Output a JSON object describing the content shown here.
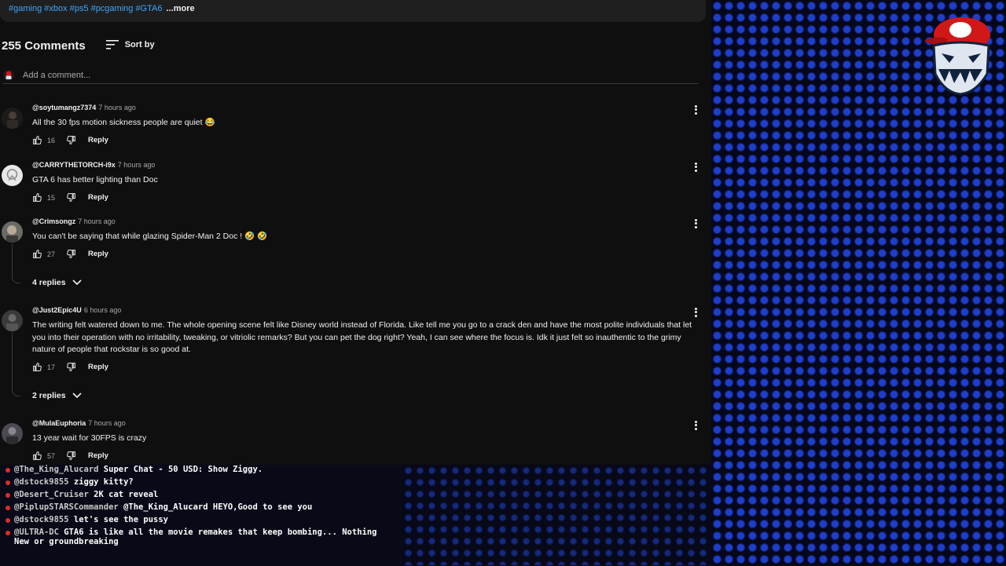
{
  "description": {
    "tags": "#gaming #xbox #ps5 #pcgaming #GTA6",
    "more_label": "...more"
  },
  "comments_header": {
    "count_label": "255 Comments",
    "sort_label": "Sort by",
    "add_comment_placeholder": "Add a comment..."
  },
  "comments": [
    {
      "author": "@soytumangz7374",
      "time": "7 hours ago",
      "text": "All the 30 fps motion sickness people are quiet 😂",
      "likes": "16",
      "reply_label": "Reply"
    },
    {
      "author": "@CARRYTHETORCH-i9x",
      "time": "7 hours ago",
      "text": "GTA 6 has better lighting than Doc",
      "likes": "15",
      "reply_label": "Reply"
    },
    {
      "author": "@Crimsongz",
      "time": "7 hours ago",
      "text": "You can't be saying that while glazing Spider-Man 2 Doc ! 🤣 🤣",
      "likes": "27",
      "reply_label": "Reply",
      "replies_label": "4 replies"
    },
    {
      "author": "@Just2Epic4U",
      "time": "6 hours ago",
      "text": "The writing felt watered down to me. The whole opening scene felt like Disney world instead of Florida. Like tell me you go to a crack den and have the most polite individuals that let you into their operation with no irritability, tweaking, or vitriolic remarks? But you can pet the dog right? Yeah, I can see where the focus is. Idk it just felt so inauthentic to the grimy nature of people that rockstar is so good at.",
      "likes": "17",
      "reply_label": "Reply",
      "replies_label": "2 replies"
    },
    {
      "author": "@MulaEuphoria",
      "time": "7 hours ago",
      "text": "13 year wait for 30FPS is crazy",
      "likes": "57",
      "reply_label": "Reply"
    }
  ],
  "live_chat": [
    {
      "user": "@The_King_Alucard",
      "message": "Super Chat - 50 USD: Show Ziggy."
    },
    {
      "user": "@dstock9855",
      "message": "ziggy kitty?"
    },
    {
      "user": "@Desert_Cruiser",
      "message": "2K cat reveal"
    },
    {
      "user": "@PiplupSTARSCommander",
      "message": "@The_King_Alucard HEYO,Good to see you"
    },
    {
      "user": "@dstock9855",
      "message": "let's see the pussy"
    },
    {
      "user": "@ULTRA-DC",
      "message": "GTA6 is like all the movie remakes that keep bombing... Nothing New or groundbreaking"
    }
  ],
  "colors": {
    "background": "#0f0f0f",
    "link_blue": "#3ea6ff",
    "led_blue": "#1e3fc9",
    "chat_dot": "#e02a2a"
  }
}
